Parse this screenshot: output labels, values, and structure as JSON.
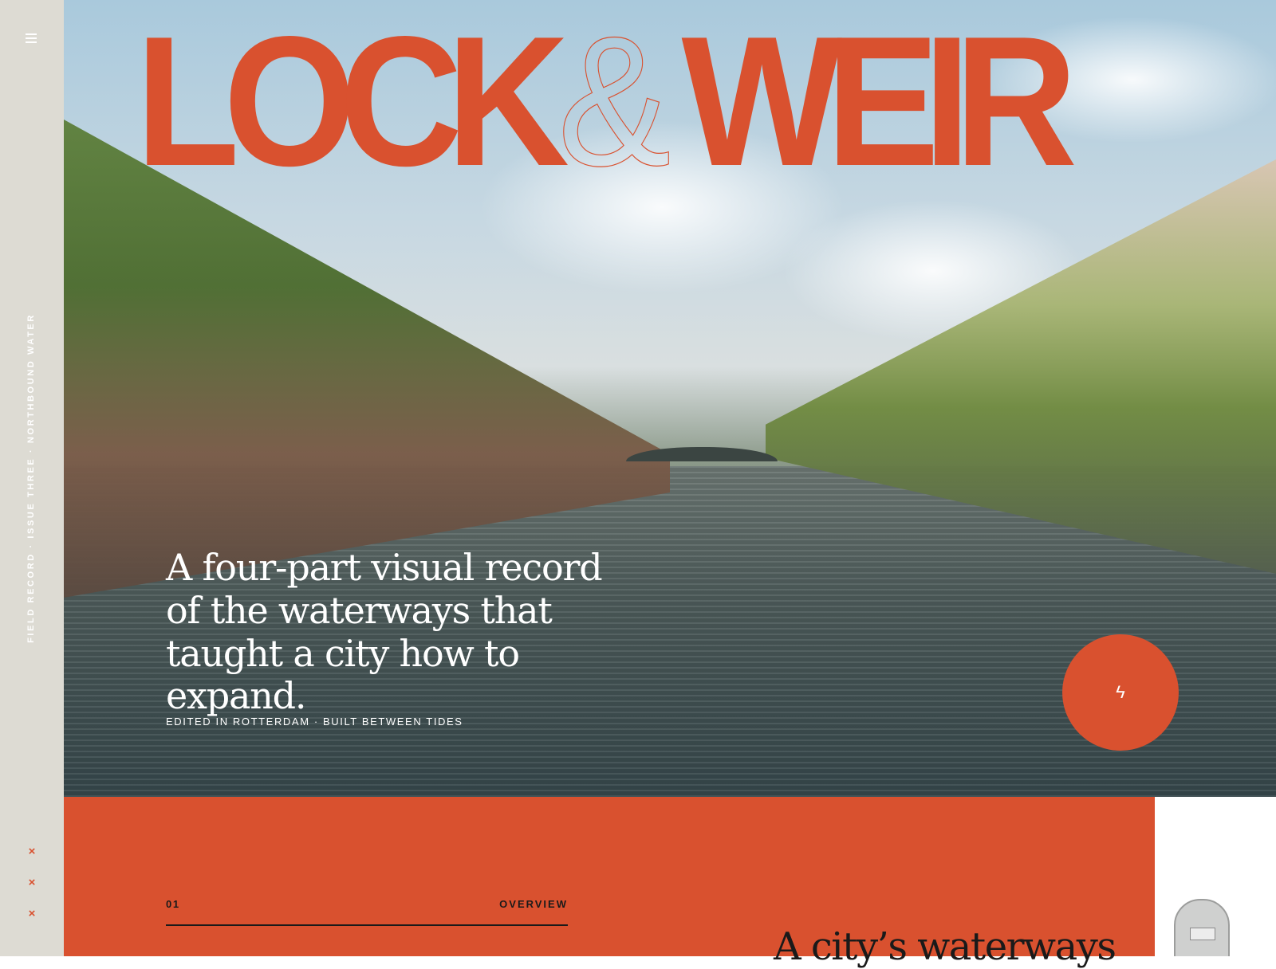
{
  "sidebar": {
    "menu_icon": "hamburger-icon",
    "vertical_text": "FIELD RECORD · ISSUE THREE · NORTHBOUND WATER",
    "marks": [
      "×",
      "×",
      "×"
    ]
  },
  "hero": {
    "title_left": "LOCK",
    "title_amp": "&",
    "title_right": "WEIR",
    "tagline": "A four-part visual record of the waterways that taught a city how to expand.",
    "subline": "EDITED IN ROTTERDAM · BUILT BETWEEN TIDES",
    "action_icon": "bolt-icon",
    "action_glyph": "ϟ"
  },
  "section": {
    "number": "01",
    "label": "OVERVIEW",
    "heading": "A city’s waterways"
  },
  "colors": {
    "accent": "#d9512f",
    "rail": "#dddbd3",
    "ink": "#1a1a1a"
  }
}
